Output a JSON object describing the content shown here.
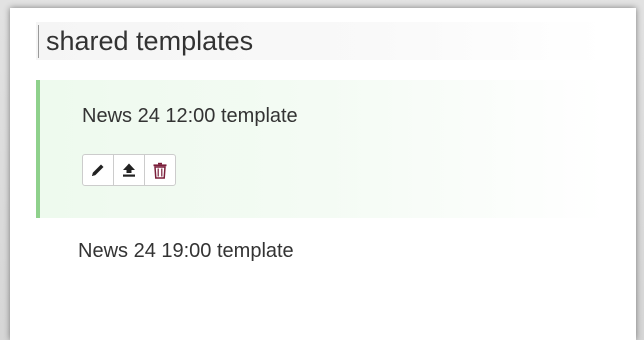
{
  "panel": {
    "title": "shared templates"
  },
  "templates": [
    {
      "name": "News 24 12:00 template",
      "selected": true,
      "actions": [
        {
          "icon": "pencil-icon",
          "action": "edit"
        },
        {
          "icon": "upload-icon",
          "action": "upload"
        },
        {
          "icon": "trash-icon",
          "action": "delete"
        }
      ]
    },
    {
      "name": "News 24 19:00 template",
      "selected": false
    }
  ],
  "colors": {
    "selected_border": "#8fd18c",
    "selected_background": "#eefaee",
    "icon": "#222222",
    "trash_icon": "#7a1e3a"
  }
}
